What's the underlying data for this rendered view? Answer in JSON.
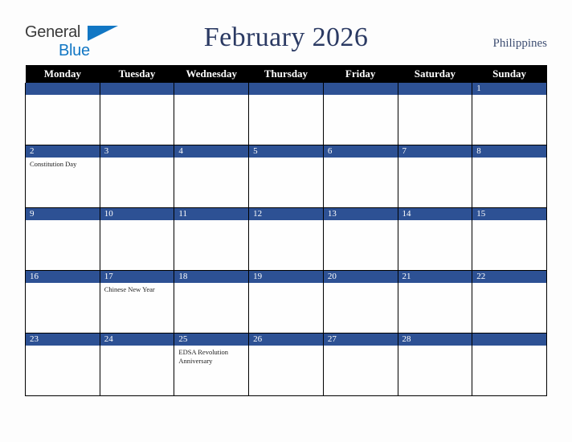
{
  "brand": {
    "name_part1": "General",
    "name_part2": "Blue",
    "accent_color": "#1277c4"
  },
  "header": {
    "title": "February 2026",
    "country": "Philippines",
    "title_color": "#2b3a63"
  },
  "calendar": {
    "weekday_headers": [
      "Monday",
      "Tuesday",
      "Wednesday",
      "Thursday",
      "Friday",
      "Saturday",
      "Sunday"
    ],
    "header_bg": "#000000",
    "daybar_bg": "#2d5194",
    "weeks": [
      [
        {
          "date": "",
          "events": []
        },
        {
          "date": "",
          "events": []
        },
        {
          "date": "",
          "events": []
        },
        {
          "date": "",
          "events": []
        },
        {
          "date": "",
          "events": []
        },
        {
          "date": "",
          "events": []
        },
        {
          "date": "1",
          "events": []
        }
      ],
      [
        {
          "date": "2",
          "events": [
            "Constitution Day"
          ]
        },
        {
          "date": "3",
          "events": []
        },
        {
          "date": "4",
          "events": []
        },
        {
          "date": "5",
          "events": []
        },
        {
          "date": "6",
          "events": []
        },
        {
          "date": "7",
          "events": []
        },
        {
          "date": "8",
          "events": []
        }
      ],
      [
        {
          "date": "9",
          "events": []
        },
        {
          "date": "10",
          "events": []
        },
        {
          "date": "11",
          "events": []
        },
        {
          "date": "12",
          "events": []
        },
        {
          "date": "13",
          "events": []
        },
        {
          "date": "14",
          "events": []
        },
        {
          "date": "15",
          "events": []
        }
      ],
      [
        {
          "date": "16",
          "events": []
        },
        {
          "date": "17",
          "events": [
            "Chinese New Year"
          ]
        },
        {
          "date": "18",
          "events": []
        },
        {
          "date": "19",
          "events": []
        },
        {
          "date": "20",
          "events": []
        },
        {
          "date": "21",
          "events": []
        },
        {
          "date": "22",
          "events": []
        }
      ],
      [
        {
          "date": "23",
          "events": []
        },
        {
          "date": "24",
          "events": []
        },
        {
          "date": "25",
          "events": [
            "EDSA Revolution Anniversary"
          ]
        },
        {
          "date": "26",
          "events": []
        },
        {
          "date": "27",
          "events": []
        },
        {
          "date": "28",
          "events": []
        },
        {
          "date": "",
          "events": []
        }
      ]
    ]
  }
}
